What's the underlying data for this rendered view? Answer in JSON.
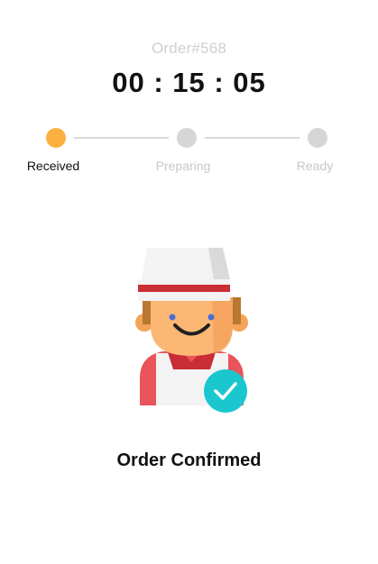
{
  "order": {
    "number_label": "Order#568",
    "timer": "00 : 15 : 05"
  },
  "progress": {
    "steps": [
      {
        "label": "Received",
        "state": "active"
      },
      {
        "label": "Preparing",
        "state": "pending"
      },
      {
        "label": "Ready",
        "state": "pending"
      }
    ],
    "colors": {
      "active_dot": "#FBB040",
      "pending_dot": "#D6D6D6",
      "active_label": "#111111",
      "pending_label": "#C8C8C8",
      "line": "#D9D9D9"
    }
  },
  "status": {
    "title": "Order Confirmed",
    "illustration_icon": "chef-illustration",
    "badge_icon": "check-circle-icon",
    "badge_color": "#1BC7CF"
  }
}
